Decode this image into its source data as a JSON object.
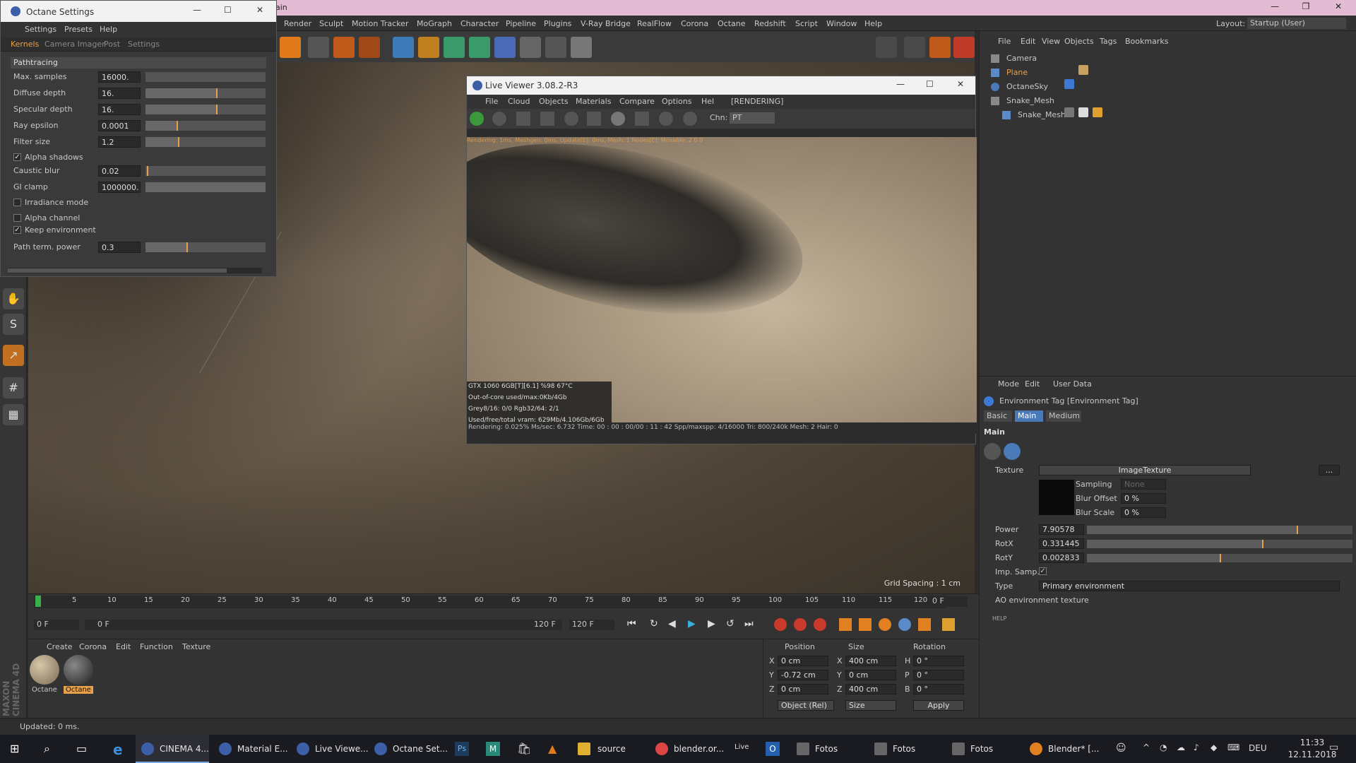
{
  "main_window": {
    "title": "ain",
    "minimize": "—",
    "maximize": "❐",
    "close": "✕"
  },
  "menubar": {
    "items": [
      "Render",
      "Sculpt",
      "Motion Tracker",
      "MoGraph",
      "Character",
      "Pipeline",
      "Plugins",
      "V-Ray Bridge",
      "RealFlow",
      "Corona",
      "Octane",
      "Redshift",
      "Script",
      "Window",
      "Help"
    ],
    "layout_label": "Layout:",
    "layout_value": "Startup (User)"
  },
  "octane_settings": {
    "title": "Octane Settings",
    "menu": [
      "Settings",
      "Presets",
      "Help"
    ],
    "tabs": [
      "Kernels",
      "Camera Imager",
      "Post",
      "Settings"
    ],
    "section": "Pathtracing",
    "rows": [
      {
        "label": "Max. samples",
        "value": "16000.",
        "fill": 0.0
      },
      {
        "label": "Diffuse depth",
        "value": "16.",
        "fill": 0.6
      },
      {
        "label": "Specular depth",
        "value": "16.",
        "fill": 0.6
      },
      {
        "label": "Ray epsilon",
        "value": "0.0001",
        "fill": 0.27
      },
      {
        "label": "Filter size",
        "value": "1.2",
        "fill": 0.28
      }
    ],
    "alpha_shadows": "Alpha shadows",
    "caustic_blur": {
      "label": "Caustic blur",
      "value": "0.02",
      "fill": 0.02
    },
    "gi_clamp": {
      "label": "GI clamp",
      "value": "1000000.",
      "fill": 1.0
    },
    "irradiance_mode": "Irradiance mode",
    "alpha_channel": "Alpha channel",
    "keep_environment": "Keep environment",
    "path_term": {
      "label": "Path term. power",
      "value": "0.3",
      "fill": 0.3
    }
  },
  "live_viewer": {
    "title": "Live Viewer 3.08.2-R3",
    "menu": [
      "File",
      "Cloud",
      "Objects",
      "Materials",
      "Compare",
      "Options",
      "Help"
    ],
    "state": "[RENDERING]",
    "chn_label": "Chn:",
    "chn_value": "PT",
    "overlay_top": "Rendering: 1ms, Meshgen: 0ms, Update[E]: 0ms, Mesh: 1 Nodes[E]: Movable: 2  0 0",
    "gpu": [
      "GTX 1060 6GB[T][6.1]     %98      67°C",
      "Out-of-core used/max:0Kb/4Gb",
      "Grey8/16: 0/0        Rgb32/64: 2/1",
      "Used/free/total vram: 629Mb/4.106Gb/6Gb"
    ],
    "status": "Rendering: 0.025%   Ms/sec: 6.732   Time: 00 : 00 : 00/00 : 11 : 42   Spp/maxspp: 4/16000   Tri: 800/240k   Mesh: 2  Hair: 0"
  },
  "object_manager": {
    "menu": [
      "File",
      "Edit",
      "View",
      "Objects",
      "Tags",
      "Bookmarks"
    ],
    "objects": [
      "Camera",
      "Plane",
      "OctaneSky",
      "Snake_Mesh",
      "Snake_Mesh"
    ]
  },
  "attribute_manager": {
    "menu": [
      "Mode",
      "Edit",
      "User Data"
    ],
    "tag_title": "Environment Tag [Environment Tag]",
    "tabs": [
      "Basic",
      "Main",
      "Medium"
    ],
    "section": "Main",
    "texture_label": "Texture",
    "texture_value": "ImageTexture",
    "texture_more": "...",
    "sampling_label": "Sampling",
    "sampling_value": "None",
    "blur_offset_label": "Blur Offset",
    "blur_offset_value": "0 %",
    "blur_scale_label": "Blur Scale",
    "blur_scale_value": "0 %",
    "power": {
      "label": "Power",
      "value": "7.90578",
      "fill": 0.79
    },
    "rotx": {
      "label": "RotX",
      "value": "0.331445",
      "fill": 0.66
    },
    "roty": {
      "label": "RotY",
      "value": "0.002833",
      "fill": 0.5
    },
    "imp_samp": "Imp. Samp.",
    "type_label": "Type",
    "type_value": "Primary environment",
    "ao_label": "AO environment texture",
    "help": "HELP"
  },
  "viewport": {
    "grid_spacing": "Grid Spacing : 1 cm"
  },
  "timeline": {
    "ticks": [
      "0",
      "5",
      "10",
      "15",
      "20",
      "25",
      "30",
      "35",
      "40",
      "45",
      "50",
      "55",
      "60",
      "65",
      "70",
      "75",
      "80",
      "85",
      "90",
      "95",
      "100",
      "105",
      "110",
      "115",
      "120"
    ],
    "current_frame": "0 F",
    "start": "0 F",
    "range_start": "0 F",
    "range_end": "120 F",
    "end": "120 F"
  },
  "material_manager": {
    "menu": [
      "Create",
      "Corona",
      "Edit",
      "Function",
      "Texture"
    ],
    "materials": [
      "Octane",
      "Octane"
    ]
  },
  "coordinates": {
    "headers": [
      "Position",
      "Size",
      "Rotation"
    ],
    "rows": [
      {
        "axis": "X",
        "pos": "0 cm",
        "saxis": "X",
        "size": "400 cm",
        "raxis": "H",
        "rot": "0 °"
      },
      {
        "axis": "Y",
        "pos": "-0.72 cm",
        "saxis": "Y",
        "size": "0 cm",
        "raxis": "P",
        "rot": "0 °"
      },
      {
        "axis": "Z",
        "pos": "0 cm",
        "saxis": "Z",
        "size": "400 cm",
        "raxis": "B",
        "rot": "0 °"
      }
    ],
    "mode": "Object (Rel)",
    "size_mode": "Size",
    "apply": "Apply"
  },
  "status": "Updated: 0 ms.",
  "branding": "MAXON CINEMA 4D",
  "taskbar": {
    "apps": [
      {
        "label": "CINEMA 4...",
        "color": "#3d5fa8"
      },
      {
        "label": "Material E...",
        "color": "#3d5fa8"
      },
      {
        "label": "Live Viewe...",
        "color": "#3d5fa8"
      },
      {
        "label": "Octane Set...",
        "color": "#3d5fa8"
      },
      {
        "label": "Ps",
        "color": "#2a5c9a"
      },
      {
        "label": "M",
        "color": "#2a8a7a"
      },
      {
        "label": "store",
        "color": "#444"
      },
      {
        "label": "vlc",
        "color": "#e07a1a"
      },
      {
        "label": "source",
        "color": "#e0b030"
      },
      {
        "label": "blender.or...",
        "color": "#d44"
      },
      {
        "label": "Live",
        "color": "#333"
      },
      {
        "label": "O",
        "color": "#2560b0"
      },
      {
        "label": "Fotos",
        "color": "#444"
      },
      {
        "label": "Fotos",
        "color": "#444"
      },
      {
        "label": "Fotos",
        "color": "#444"
      },
      {
        "label": "Blender* [...",
        "color": "#e08020"
      }
    ],
    "lang": "DEU",
    "time": "11:33",
    "date": "12.11.2018"
  }
}
